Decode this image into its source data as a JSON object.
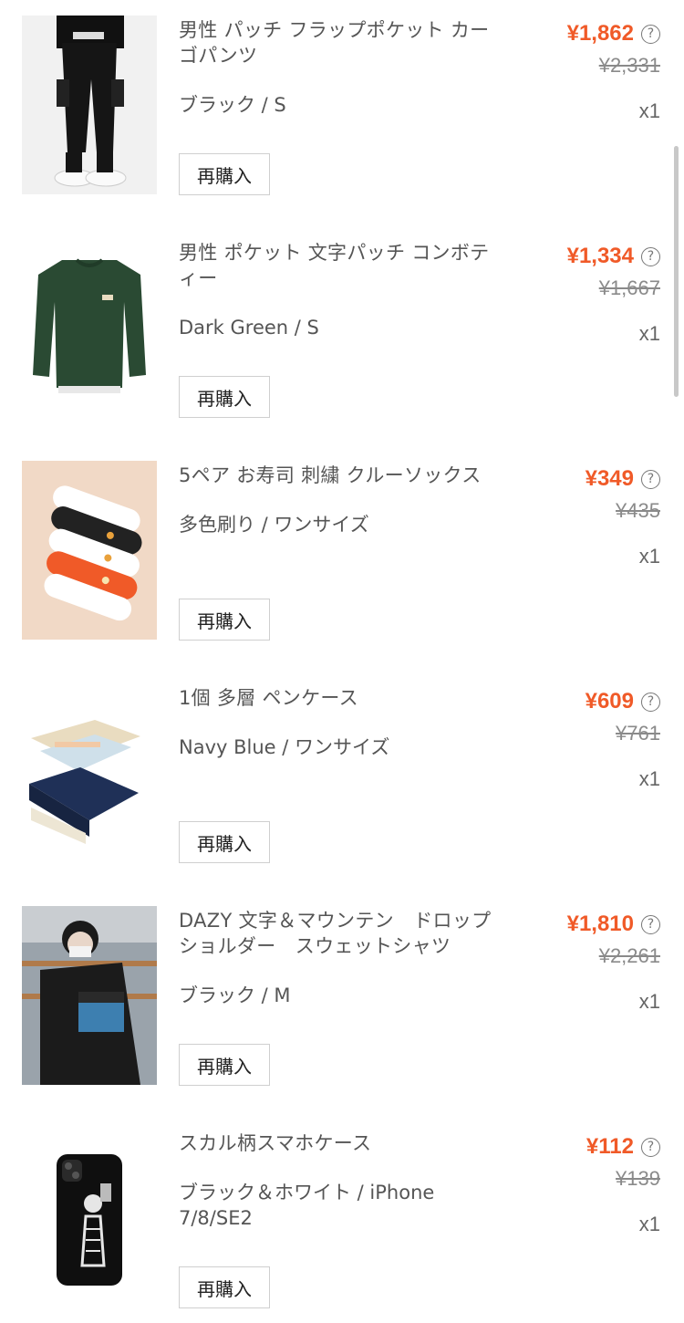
{
  "orders": [
    {
      "title": "男性 パッチ フラップポケット カーゴパンツ",
      "variant": "ブラック / S",
      "price": "¥1,862",
      "original_price": "¥2,331",
      "quantity": "x1",
      "rebuy_label": "再購入",
      "thumb": "cargo-pants"
    },
    {
      "title": "男性 ポケット 文字パッチ コンボティー",
      "variant": "Dark Green / S",
      "price": "¥1,334",
      "original_price": "¥1,667",
      "quantity": "x1",
      "rebuy_label": "再購入",
      "thumb": "green-tee"
    },
    {
      "title": "5ペア お寿司 刺繍 クルーソックス",
      "variant": "多色刷り / ワンサイズ",
      "price": "¥349",
      "original_price": "¥435",
      "quantity": "x1",
      "rebuy_label": "再購入",
      "thumb": "socks"
    },
    {
      "title": "1個 多層 ペンケース",
      "variant": "Navy Blue / ワンサイズ",
      "price": "¥609",
      "original_price": "¥761",
      "quantity": "x1",
      "rebuy_label": "再購入",
      "thumb": "pencil-case"
    },
    {
      "title": "DAZY 文字＆マウンテン　ドロップショルダー　スウェットシャツ",
      "variant": "ブラック / M",
      "price": "¥1,810",
      "original_price": "¥2,261",
      "quantity": "x1",
      "rebuy_label": "再購入",
      "thumb": "sweatshirt"
    },
    {
      "title": "スカル柄スマホケース",
      "variant": "ブラック＆ホワイト / iPhone 7/8/SE2",
      "price": "¥112",
      "original_price": "¥139",
      "quantity": "x1",
      "rebuy_label": "再購入",
      "thumb": "phone-case"
    }
  ],
  "help_icon": "question-circle-icon",
  "colors": {
    "price": "#f05a28",
    "text": "#555555",
    "strike": "#8a8a8a"
  }
}
